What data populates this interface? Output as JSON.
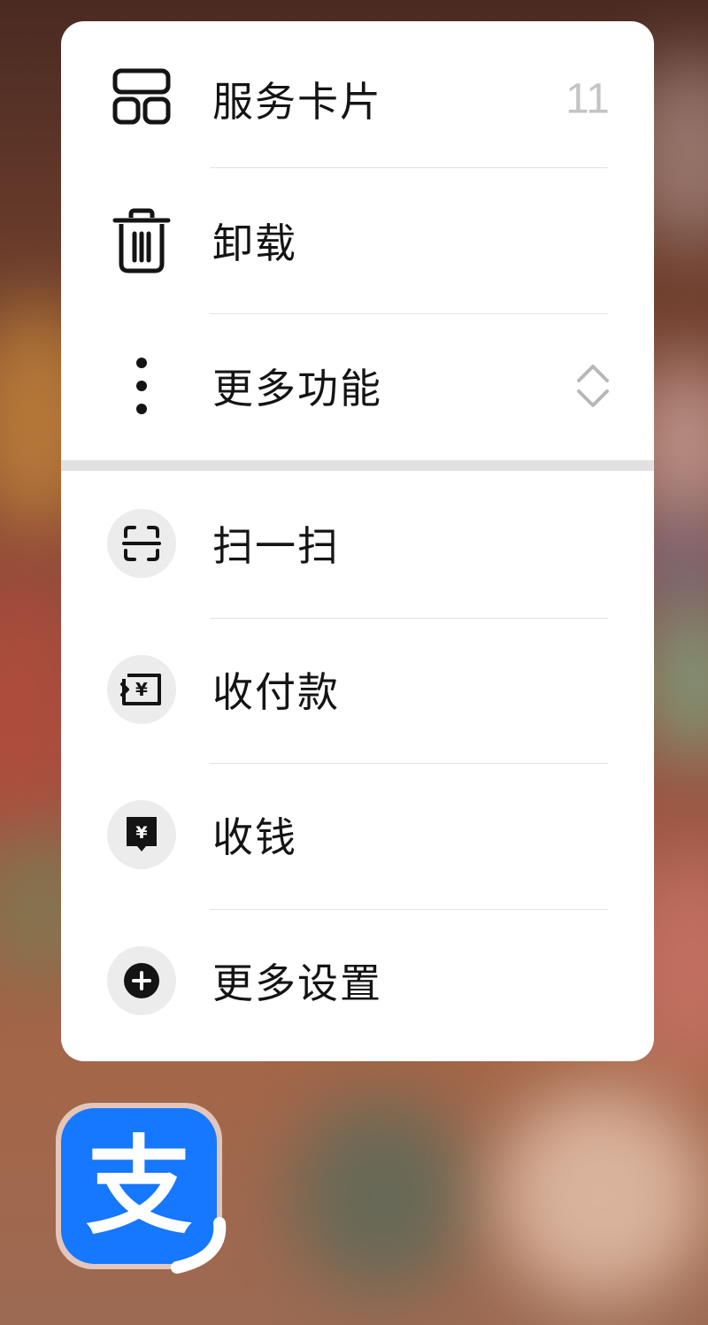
{
  "menu": {
    "top_items": [
      {
        "label": "服务卡片",
        "icon": "widget-cards-icon",
        "count": "11"
      },
      {
        "label": "卸载",
        "icon": "trash-icon"
      },
      {
        "label": "更多功能",
        "icon": "more-vertical-icon",
        "trailing_icon": "expand-collapse-icon"
      }
    ],
    "shortcut_items": [
      {
        "label": "扫一扫",
        "icon": "scan-icon"
      },
      {
        "label": "收付款",
        "icon": "pay-receive-icon"
      },
      {
        "label": "收钱",
        "icon": "collect-money-icon"
      },
      {
        "label": "更多设置",
        "icon": "plus-circle-icon"
      }
    ]
  },
  "app": {
    "name": "支付宝",
    "icon": "alipay-logo-icon",
    "logo_glyph": "支",
    "brand_color": "#1677ff"
  },
  "colors": {
    "menu_bg": "#ffffff",
    "text": "#141414",
    "divider": "#e2e2e2",
    "icon_circle": "#ececec"
  }
}
